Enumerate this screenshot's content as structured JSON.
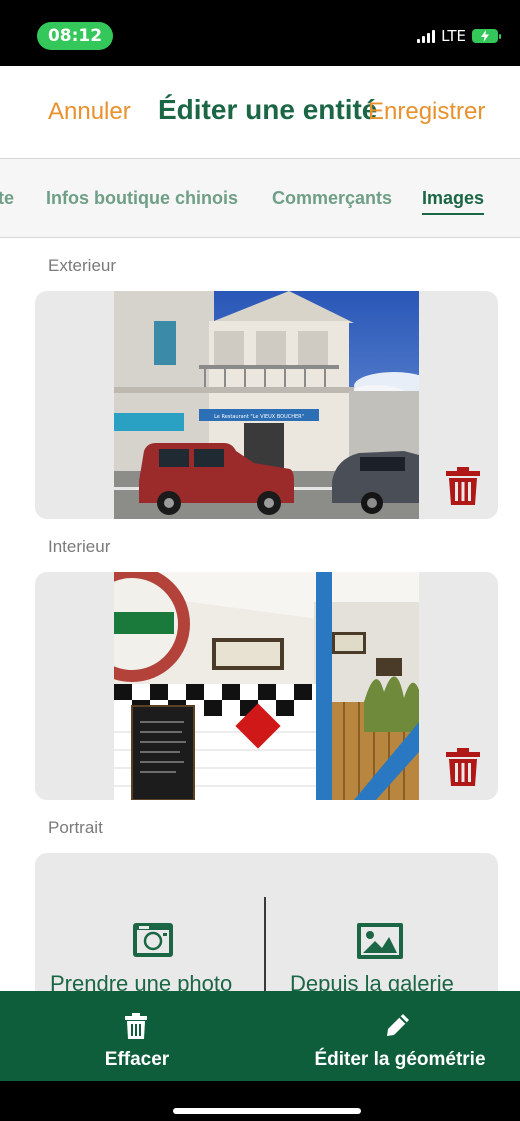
{
  "status_bar": {
    "time": "08:12",
    "network": "LTE"
  },
  "nav": {
    "cancel": "Annuler",
    "title": "Éditer une entité",
    "save": "Enregistrer"
  },
  "tabs": [
    {
      "label": "te"
    },
    {
      "label": "Infos boutique chinois"
    },
    {
      "label": "Commerçants"
    },
    {
      "label": "Images",
      "active": true
    }
  ],
  "sections": {
    "exterior": {
      "label": "Exterieur"
    },
    "interior": {
      "label": "Interieur"
    },
    "portrait": {
      "label": "Portrait",
      "take_photo": "Prendre une photo",
      "from_gallery": "Depuis la galerie"
    }
  },
  "photo_exterior": {
    "shop_sign": "Le Restaurant \"Le VIEUX BOUCHER\""
  },
  "bottom_bar": {
    "clear": "Effacer",
    "edit_geometry": "Éditer la géométrie"
  },
  "icons": {
    "trash": "trash-icon",
    "camera": "camera-icon",
    "gallery": "image-icon",
    "clear": "trash-icon",
    "edit": "pencil-icon"
  },
  "colors": {
    "brand_green": "#1b6645",
    "accent_orange": "#e8912d",
    "delete_red": "#b01818",
    "bottom_bar": "#0e5e3c"
  }
}
